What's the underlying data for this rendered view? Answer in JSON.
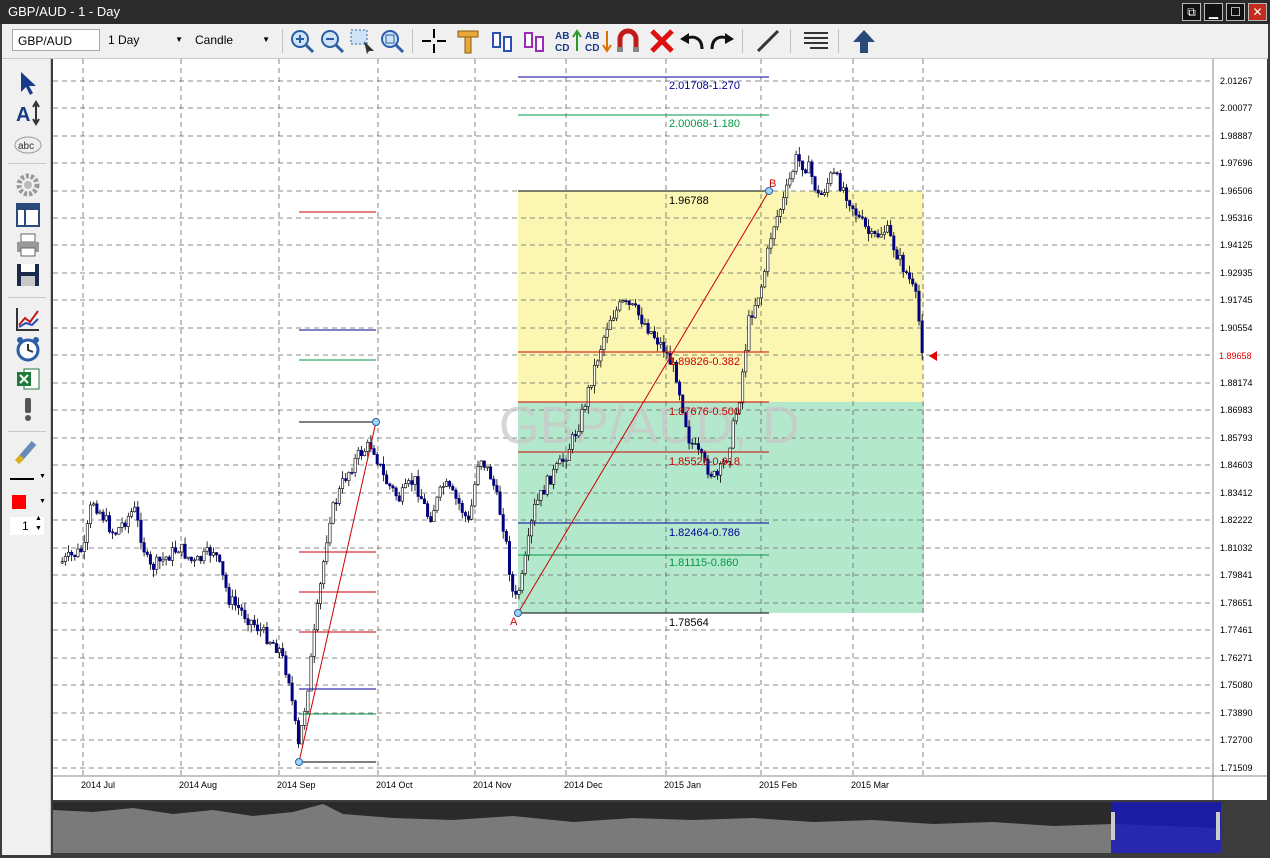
{
  "window": {
    "title": "GBP/AUD - 1 - Day",
    "buttons": {
      "restore": "⧉",
      "minimize": "▁",
      "maximize": "☐",
      "close": "✕"
    }
  },
  "toolbar": {
    "symbol": "GBP/AUD",
    "timeframe": "1 Day",
    "chart_type": "Candle",
    "icons": [
      "zoom-in-icon",
      "zoom-out-icon",
      "zoom-box-icon",
      "zoom-reset-icon",
      "crosshair-icon",
      "ruler-icon",
      "candle-compare-icon",
      "candle-compare-alt-icon",
      "abcd-up-icon",
      "abcd-down-icon",
      "magnet-icon",
      "delete-all-icon",
      "undo-icon",
      "redo-icon",
      "trendline-icon",
      "hlines-icon",
      "arrow-up-icon"
    ]
  },
  "left_toolbar": {
    "icons": [
      "pointer-icon",
      "text-tool-icon",
      "abc-label-icon",
      "settings-gear-icon",
      "layout-icon",
      "print-icon",
      "save-icon",
      "indicator-chart-icon",
      "alarm-clock-icon",
      "excel-export-icon",
      "alert-exclamation-icon",
      "brush-icon"
    ],
    "line_style": "solid",
    "color": "#ff0000",
    "line_width": "1"
  },
  "chart": {
    "watermark": "GBP/AUD, D",
    "price_axis": [
      "2.01267",
      "2.00077",
      "1.98887",
      "1.97696",
      "1.96506",
      "1.95316",
      "1.94125",
      "1.92935",
      "1.91745",
      "1.90554",
      "1.88174",
      "1.86983",
      "1.85793",
      "1.84603",
      "1.83412",
      "1.82222",
      "1.81032",
      "1.79841",
      "1.78651",
      "1.77461",
      "1.76271",
      "1.75080",
      "1.73890",
      "1.72700",
      "1.71509"
    ],
    "current_price": "1.89658",
    "current_price_color": "#e00000",
    "date_axis": [
      "2014 Jul",
      "2014 Aug",
      "2014 Sep",
      "2014 Oct",
      "2014 Nov",
      "2014 Dec",
      "2015 Jan",
      "2015 Feb",
      "2015 Mar"
    ],
    "pattern_points": {
      "a": "A",
      "b": "B"
    },
    "fib_labels": {
      "ext_1270": "2.01708-1.270",
      "ext_1180": "2.00068-1.180",
      "high": "1.96788",
      "lvl_382": "1.89826-0.382",
      "lvl_500": "1.87676-0.500",
      "lvl_618": "1.85526-0.618",
      "lvl_786": "1.82464-0.786",
      "lvl_860": "1.81115-0.860",
      "low": "1.78564"
    },
    "colors": {
      "up_zone": "#fbf7b3",
      "down_zone": "#b3e8cc",
      "candle_up": "#ffffff",
      "candle_down": "#000080",
      "fib_red": "#cc0000",
      "fib_blue": "#000099",
      "fib_green": "#009944"
    }
  },
  "navigator": {
    "visible": true
  }
}
